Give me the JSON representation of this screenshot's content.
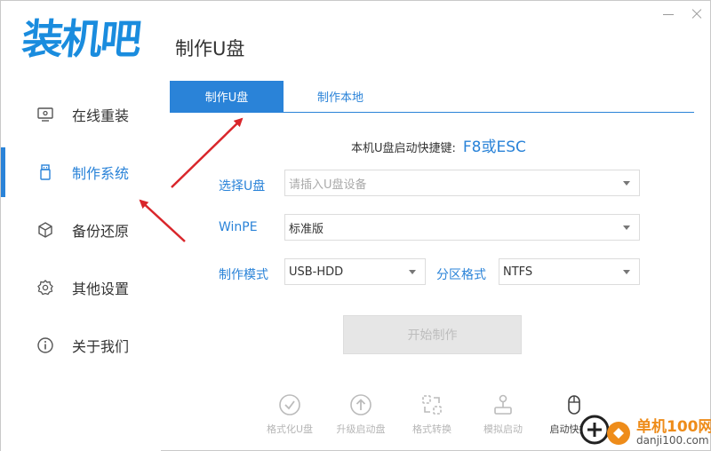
{
  "app": {
    "logo_text": "装机吧",
    "page_title": "制作U盘"
  },
  "sidebar": {
    "items": [
      {
        "label": "在线重装",
        "icon": "monitor-icon",
        "active": false
      },
      {
        "label": "制作系统",
        "icon": "usb-drive-icon",
        "active": true
      },
      {
        "label": "备份还原",
        "icon": "cube-icon",
        "active": false
      },
      {
        "label": "其他设置",
        "icon": "gear-icon",
        "active": false
      },
      {
        "label": "关于我们",
        "icon": "info-icon",
        "active": false
      }
    ]
  },
  "tabs": [
    {
      "label": "制作U盘",
      "active": true
    },
    {
      "label": "制作本地",
      "active": false
    }
  ],
  "hotkey": {
    "label": "本机U盘启动快捷键:",
    "value": "F8或ESC"
  },
  "form": {
    "usb": {
      "label": "选择U盘",
      "placeholder": "请插入U盘设备"
    },
    "winpe": {
      "label": "WinPE",
      "value": "标准版"
    },
    "mode": {
      "label": "制作模式",
      "value": "USB-HDD"
    },
    "partition": {
      "label": "分区格式",
      "value": "NTFS"
    }
  },
  "start_button": {
    "label": "开始制作"
  },
  "tools": [
    {
      "label": "格式化U盘",
      "icon": "check-circle-icon"
    },
    {
      "label": "升级启动盘",
      "icon": "upload-circle-icon"
    },
    {
      "label": "格式转换",
      "icon": "convert-icon"
    },
    {
      "label": "模拟启动",
      "icon": "joystick-icon"
    },
    {
      "label": "启动快捷键",
      "icon": "mouse-icon"
    }
  ],
  "watermark": {
    "name": "单机100网",
    "url": "danji100.com"
  },
  "colors": {
    "accent": "#2a83d8",
    "annotation_arrow": "#d9262b",
    "watermark_orange": "#ee8c1a"
  }
}
